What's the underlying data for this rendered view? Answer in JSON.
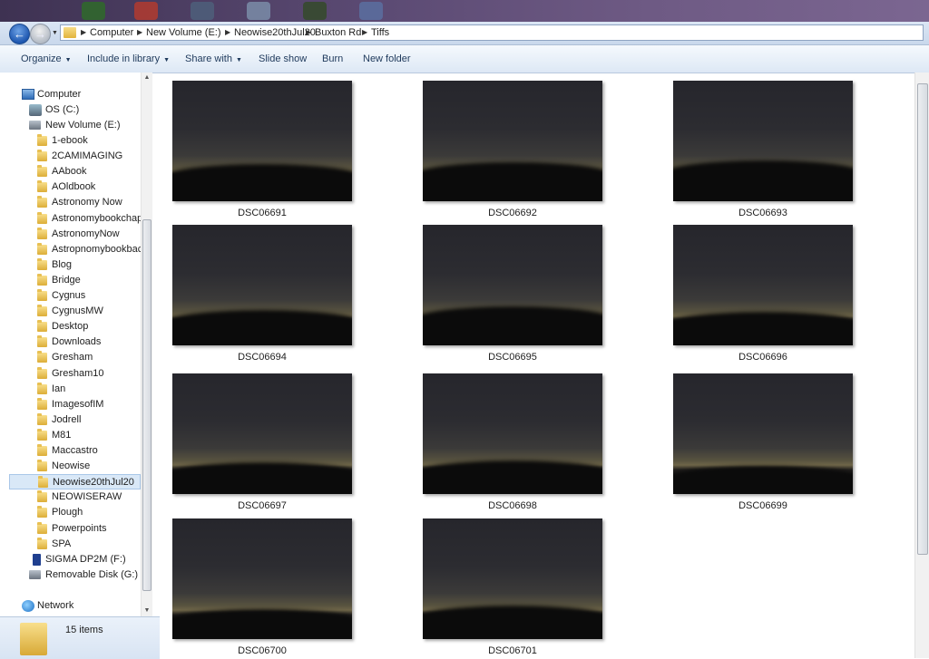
{
  "breadcrumbs": [
    "Computer",
    "New Volume (E:)",
    "Neowise20thJul20",
    "Buxton Rd",
    "Tiffs"
  ],
  "toolbar": {
    "organize": "Organize",
    "include_in_library": "Include in library",
    "share_with": "Share with",
    "slide_show": "Slide show",
    "burn": "Burn",
    "new_folder": "New folder"
  },
  "nav": {
    "computer": "Computer",
    "os_c": "OS (C:)",
    "new_volume_e": "New Volume (E:)",
    "folders": [
      "1-ebook",
      "2CAMIMAGING",
      "AAbook",
      "AOldbook",
      "Astronomy Now",
      "Astronomybookchapt",
      "AstronomyNow",
      "Astropnomybookback",
      "Blog",
      "Bridge",
      "Cygnus",
      "CygnusMW",
      "Desktop",
      "Downloads",
      "Gresham",
      "Gresham10",
      "Ian",
      "ImagesofIM",
      "Jodrell",
      "M81",
      "Maccastro",
      "Neowise",
      "Neowise20thJul20",
      "NEOWISERAW",
      "Plough",
      "Powerpoints",
      "SPA"
    ],
    "selected_folder": "Neowise20thJul20",
    "sigma": "SIGMA DP2M (F:)",
    "removable": "Removable Disk (G:)",
    "network": "Network"
  },
  "files": [
    "DSC06691",
    "DSC06692",
    "DSC06693",
    "DSC06694",
    "DSC06695",
    "DSC06696",
    "DSC06697",
    "DSC06698",
    "DSC06699",
    "DSC06700",
    "DSC06701"
  ],
  "details": {
    "count": "15 items"
  },
  "icons": {
    "back": "back-arrow-icon",
    "forward": "forward-arrow-icon",
    "folder": "folder-icon",
    "computer": "computer-icon",
    "network": "network-icon",
    "drive": "drive-icon"
  }
}
